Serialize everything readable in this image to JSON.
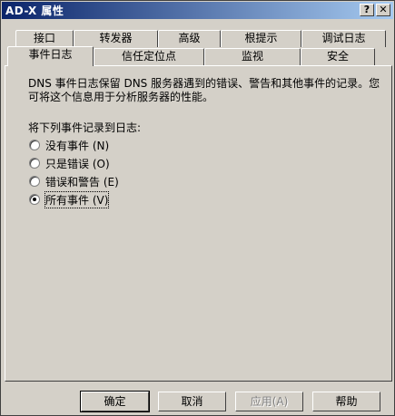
{
  "window": {
    "title": "AD-X 属性",
    "help_glyph": "?",
    "close_glyph": "✕"
  },
  "tabs": {
    "back_row": [
      "接口",
      "转发器",
      "高级",
      "根提示",
      "调试日志"
    ],
    "front_row": [
      "事件日志",
      "信任定位点",
      "监视",
      "安全"
    ],
    "active": "事件日志"
  },
  "panel": {
    "description": "DNS 事件日志保留 DNS 服务器遇到的错误、警告和其他事件的记录。您可将这个信息用于分析服务器的性能。",
    "group_label": "将下列事件记录到日志:",
    "options": [
      {
        "label": "没有事件",
        "accel": "(N)",
        "selected": false
      },
      {
        "label": "只是错误",
        "accel": "(O)",
        "selected": false
      },
      {
        "label": "错误和警告",
        "accel": "(E)",
        "selected": false
      },
      {
        "label": "所有事件",
        "accel": "(V)",
        "selected": true
      }
    ]
  },
  "buttons": {
    "ok": "确定",
    "cancel": "取消",
    "apply": "应用(A)",
    "help": "帮助"
  }
}
